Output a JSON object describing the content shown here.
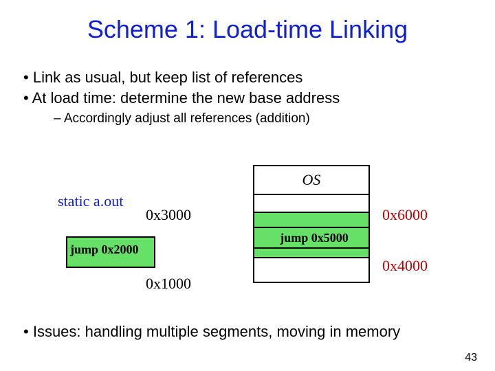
{
  "title": "Scheme 1: Load-time Linking",
  "bullets": {
    "b1": "Link as usual, but keep list of references",
    "b2": "At load time: determine the new base address",
    "sub": "Accordingly adjust all references (addition)"
  },
  "diagram": {
    "static_label": "static a.out",
    "left_top_addr": "0x3000",
    "left_jump": "jump 0x2000",
    "left_bot_addr": "0x1000",
    "os_label": "OS",
    "right_6000": "0x6000",
    "right_jump": "jump 0x5000",
    "right_4000": "0x4000"
  },
  "issues": "Issues: handling multiple segments, moving in memory",
  "page_number": "43"
}
